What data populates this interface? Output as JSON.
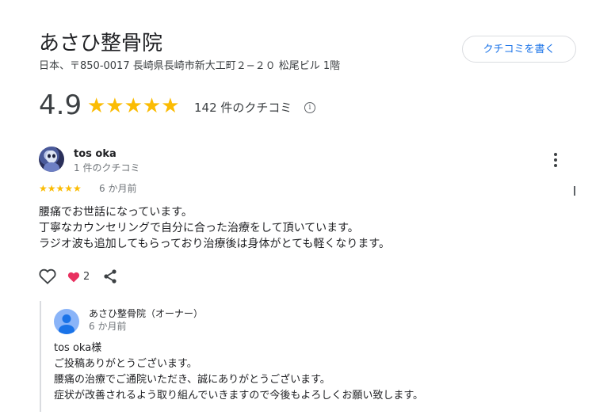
{
  "business": {
    "name": "あさひ整骨院",
    "address": "日本、〒850-0017 長崎県長崎市新大工町２−２０ 松尾ビル 1階",
    "write_review_label": "クチコミを書く"
  },
  "rating": {
    "score": "4.9",
    "stars": "★★★★★",
    "count_text": "142 件のクチコミ",
    "info_icon": "info-icon"
  },
  "review": {
    "reviewer_name": "tos oka",
    "reviewer_meta": "1 件のクチコミ",
    "stars": "★★★★★",
    "rating_value": 5,
    "date": "6 か月前",
    "text_lines": [
      "腰痛でお世話になっています。",
      "丁寧なカウンセリングで自分に合った治療をして頂いています。",
      "ラジオ波も追加してもらっており治療後は身体がとても軽くなります。"
    ],
    "reaction_count": "2",
    "icons": {
      "like": "heart-outline-icon",
      "reaction": "heart-filled-icon",
      "share": "share-icon",
      "more": "more-vertical-icon"
    }
  },
  "owner_reply": {
    "name": "あさひ整骨院（オーナー）",
    "date": "6 か月前",
    "text_lines": [
      "tos oka様",
      "ご投稿ありがとうございます。",
      "腰痛の治療でご通院いただき、誠にありがとうございます。",
      "症状が改善されるよう取り組んでいきますので今後もよろしくお願い致します。"
    ]
  },
  "colors": {
    "star": "#fbbc04",
    "accent": "#1a73e8",
    "heart": "#e8305f",
    "owner_avatar": "#8ab4f8"
  }
}
